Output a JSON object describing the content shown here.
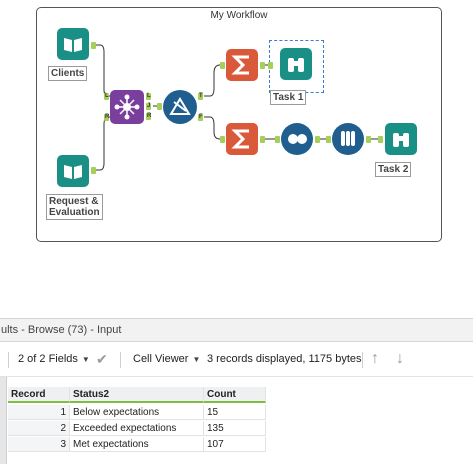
{
  "workflow": {
    "title": "My Workflow",
    "tools": {
      "clients": {
        "label": "Clients"
      },
      "request": {
        "label": "Request &\nEvaluation"
      },
      "task1": {
        "label": "Task 1"
      },
      "task2": {
        "label": "Task 2"
      }
    },
    "anchors": {
      "join_left": "L",
      "join_right": "R",
      "join_out_left": "L",
      "join_out_join": "J",
      "join_out_right": "R",
      "filter_true": "T",
      "filter_false": "F"
    }
  },
  "results": {
    "title": "ults - Browse (73) - Input",
    "toolbar": {
      "fields": "2 of 2 Fields",
      "viewer": "Cell Viewer",
      "status": "3 records displayed, 1175 bytes"
    },
    "columns": [
      "Record",
      "Status2",
      "Count"
    ],
    "rows": [
      {
        "record": "1",
        "status": "Below expectations",
        "count": "15"
      },
      {
        "record": "2",
        "status": "Exceeded expectations",
        "count": "135"
      },
      {
        "record": "3",
        "status": "Met expectations",
        "count": "107"
      }
    ]
  },
  "colors": {
    "input_teal": "#1a8f86",
    "join_purple": "#7a3e9d",
    "filter_blue": "#1f5e8e",
    "summarize_orange": "#d9593a",
    "unique_blue": "#1f5e8e",
    "formula_blue": "#1f5e8e",
    "browse_teal": "#1a8f86",
    "anchor_green": "#a6cf5a"
  }
}
